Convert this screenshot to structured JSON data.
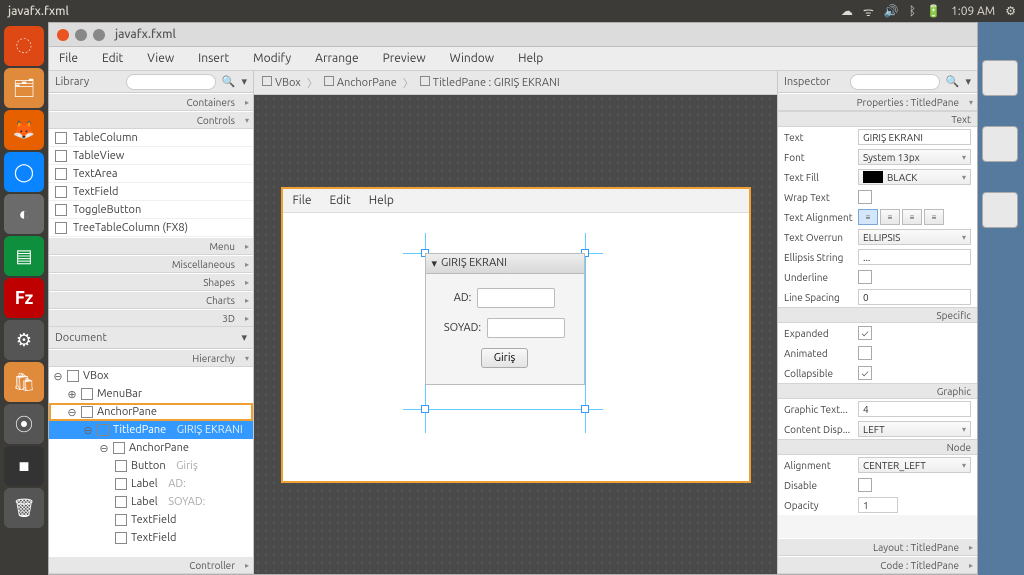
{
  "ubuntu": {
    "title": "javafx.fxml",
    "time": "1:09 AM",
    "indicators": [
      "cloud",
      "wifi",
      "vol",
      "bt",
      "batt"
    ]
  },
  "window": {
    "title": "javafx.fxml"
  },
  "menubar": [
    "File",
    "Edit",
    "View",
    "Insert",
    "Modify",
    "Arrange",
    "Preview",
    "Window",
    "Help"
  ],
  "library": {
    "title": "Library",
    "sections": {
      "containers": "Containers",
      "controls": "Controls",
      "menu": "Menu",
      "misc": "Miscellaneous",
      "shapes": "Shapes",
      "charts": "Charts",
      "threeD": "3D"
    },
    "controls_items": [
      "TableColumn",
      "TableView",
      "TextArea",
      "TextField",
      "ToggleButton",
      "TreeTableColumn   (FX8)"
    ]
  },
  "document": {
    "title": "Document",
    "hierarchy": "Hierarchy",
    "controller": "Controller",
    "tree": {
      "vbox": "VBox",
      "menubar": "MenuBar",
      "anchor1": "AnchorPane",
      "titledpane": "TitledPane",
      "titledpane_sub": "GIRIŞ EKRANI",
      "anchor2": "AnchorPane",
      "button": "Button",
      "button_sub": "Giriş",
      "label_ad": "Label",
      "label_ad_sub": "AD:",
      "label_soyad": "Label",
      "label_soyad_sub": "SOYAD:",
      "tf1": "TextField",
      "tf2": "TextField"
    }
  },
  "breadcrumb": {
    "b1": "VBox",
    "b2": "AnchorPane",
    "b3": "TitledPane : GIRIŞ EKRANI"
  },
  "preview": {
    "menus": [
      "File",
      "Edit",
      "Help"
    ],
    "titled_head": "GIRIŞ EKRANI",
    "label_ad": "AD:",
    "label_soyad": "SOYAD:",
    "button": "Giriş"
  },
  "inspector": {
    "title": "Inspector",
    "props_for": "Properties : TitledPane",
    "sections": {
      "text": "Text",
      "specific": "Specific",
      "graphic": "Graphic",
      "node": "Node"
    },
    "rows": {
      "text_l": "Text",
      "text_v": "GIRIŞ EKRANI",
      "font_l": "Font",
      "font_v": "System 13px",
      "fill_l": "Text Fill",
      "fill_v": "BLACK",
      "wrap_l": "Wrap Text",
      "align_l": "Text Alignment",
      "overrun_l": "Text Overrun",
      "overrun_v": "ELLIPSIS",
      "ellip_l": "Ellipsis String",
      "ellip_v": "...",
      "under_l": "Underline",
      "lsp_l": "Line Spacing",
      "lsp_v": "0",
      "exp_l": "Expanded",
      "anim_l": "Animated",
      "coll_l": "Collapsible",
      "gtext_l": "Graphic Text...",
      "gtext_v": "4",
      "cdisp_l": "Content Disp...",
      "cdisp_v": "LEFT",
      "nalign_l": "Alignment",
      "nalign_v": "CENTER_LEFT",
      "disable_l": "Disable",
      "opacity_l": "Opacity",
      "opacity_v": "1"
    }
  },
  "status": {
    "layout": "Layout : TitledPane",
    "code": "Code : TitledPane"
  }
}
